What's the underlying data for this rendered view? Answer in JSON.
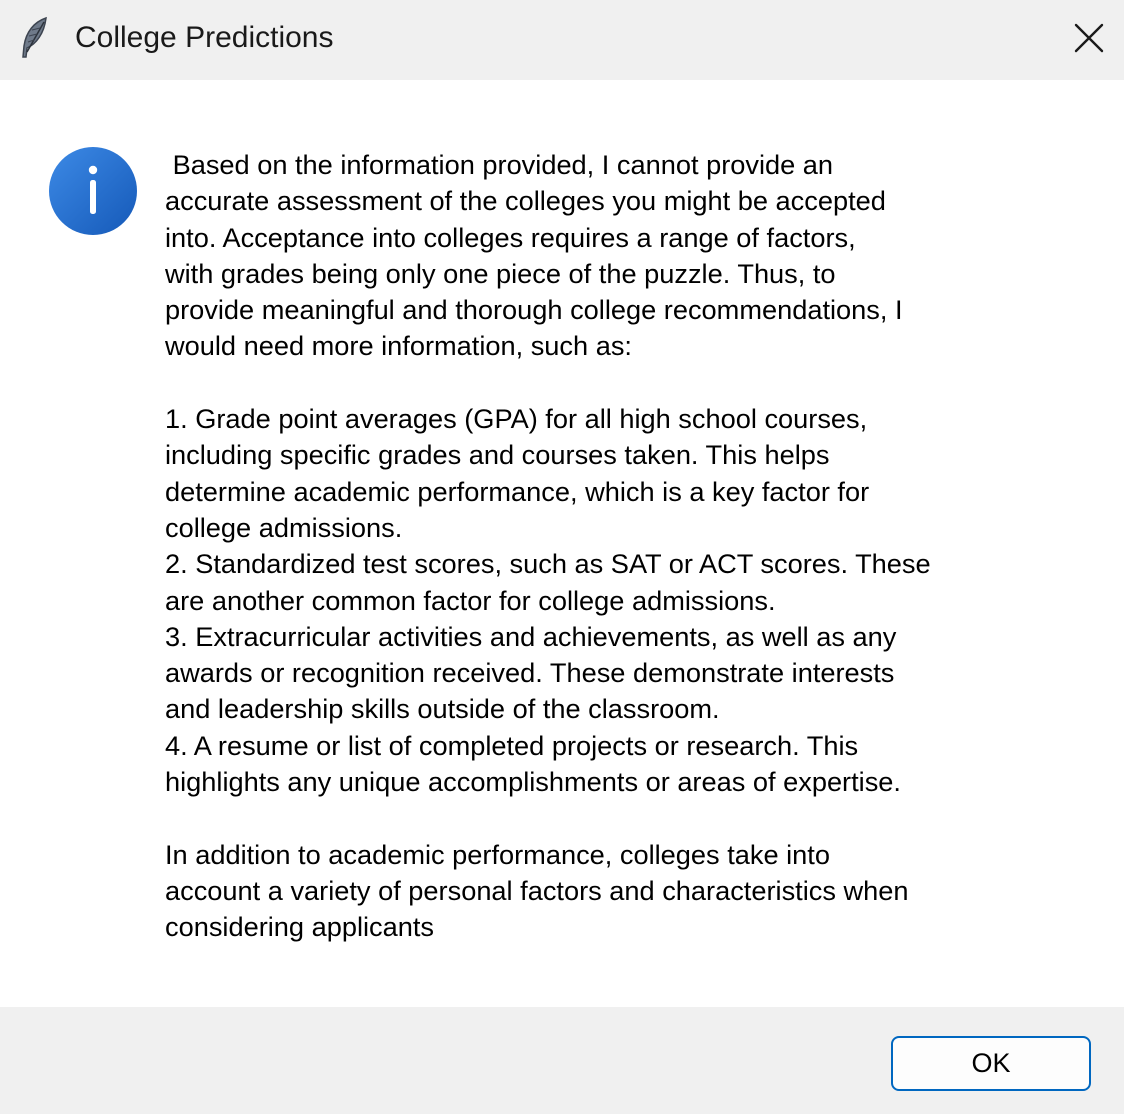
{
  "window": {
    "title": "College Predictions",
    "app_icon": "feather-icon",
    "close_icon": "close-icon"
  },
  "dialog": {
    "icon": "info-icon",
    "message": " Based on the information provided, I cannot provide an\naccurate assessment of the colleges you might be accepted\ninto. Acceptance into colleges requires a range of factors,\nwith grades being only one piece of the puzzle. Thus, to\nprovide meaningful and thorough college recommendations, I\nwould need more information, such as:\n\n1. Grade point averages (GPA) for all high school courses,\nincluding specific grades and courses taken. This helps\ndetermine academic performance, which is a key factor for\ncollege admissions.\n2. Standardized test scores, such as SAT or ACT scores. These\nare another common factor for college admissions.\n3. Extracurricular activities and achievements, as well as any\nawards or recognition received. These demonstrate interests\nand leadership skills outside of the classroom.\n4. A resume or list of completed projects or research. This\nhighlights any unique accomplishments or areas of expertise.\n\nIn addition to academic performance, colleges take into\naccount a variety of personal factors and characteristics when\nconsidering applicants"
  },
  "buttons": {
    "ok_label": "OK"
  },
  "colors": {
    "titlebar_bg": "#f0f0f0",
    "content_bg": "#ffffff",
    "footer_bg": "#f0f0f0",
    "info_icon_blue": "#1e6fd1",
    "ok_border": "#0067c0"
  }
}
